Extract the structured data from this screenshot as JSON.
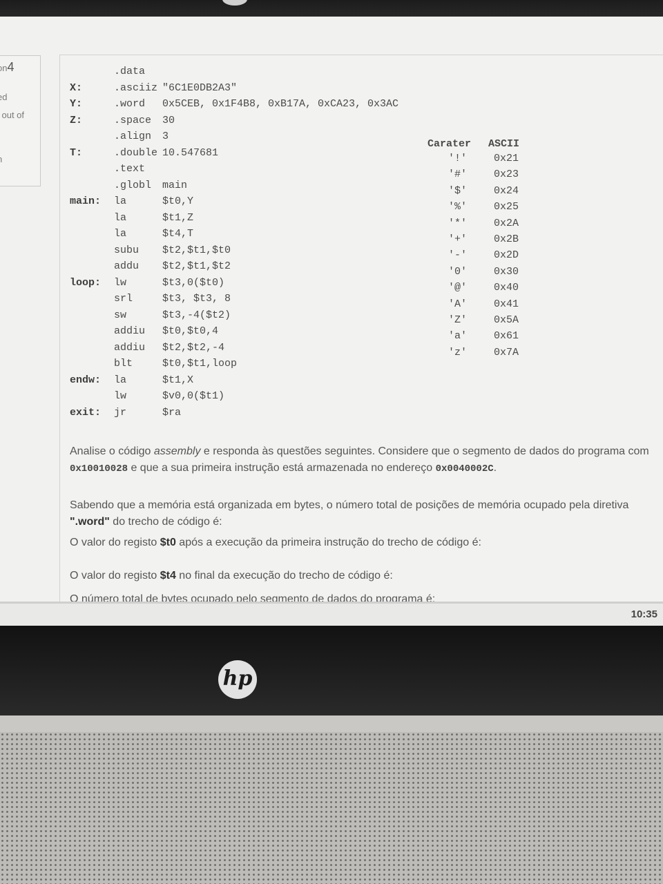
{
  "sidebar": {
    "question_prefix": "on",
    "question_number": "4",
    "line1": "ed",
    "line2": "l out of",
    "line3": "n"
  },
  "code": [
    {
      "label": "",
      "op": ".data",
      "args": ""
    },
    {
      "label": "X:",
      "op": ".asciiz",
      "args": "\"6C1E0DB2A3\""
    },
    {
      "label": "Y:",
      "op": ".word",
      "args": "0x5CEB, 0x1F4B8, 0xB17A, 0xCA23, 0x3AC"
    },
    {
      "label": "Z:",
      "op": ".space",
      "args": "30"
    },
    {
      "label": "",
      "op": ".align",
      "args": "3"
    },
    {
      "label": "T:",
      "op": ".double",
      "args": "10.547681"
    },
    {
      "label": "",
      "op": ".text",
      "args": ""
    },
    {
      "label": "",
      "op": ".globl",
      "args": "main"
    },
    {
      "label": "main:",
      "op": "la",
      "args": "$t0,Y"
    },
    {
      "label": "",
      "op": "la",
      "args": "$t1,Z"
    },
    {
      "label": "",
      "op": "la",
      "args": "$t4,T"
    },
    {
      "label": "",
      "op": "subu",
      "args": "$t2,$t1,$t0"
    },
    {
      "label": "",
      "op": "addu",
      "args": "$t2,$t1,$t2"
    },
    {
      "label": "loop:",
      "op": "lw",
      "args": "$t3,0($t0)"
    },
    {
      "label": "",
      "op": "srl",
      "args": "$t3, $t3, 8"
    },
    {
      "label": "",
      "op": "sw",
      "args": "$t3,-4($t2)"
    },
    {
      "label": "",
      "op": "addiu",
      "args": "$t0,$t0,4"
    },
    {
      "label": "",
      "op": "addiu",
      "args": "$t2,$t2,-4"
    },
    {
      "label": "",
      "op": "blt",
      "args": "$t0,$t1,loop"
    },
    {
      "label": "endw:",
      "op": "la",
      "args": "$t1,X"
    },
    {
      "label": "",
      "op": "lw",
      "args": "$v0,0($t1)"
    },
    {
      "label": "exit:",
      "op": "jr",
      "args": "$ra"
    }
  ],
  "ascii_table": {
    "header_char": "Carater",
    "header_ascii": "ASCII",
    "rows": [
      {
        "ch": "'!'",
        "hex": "0x21"
      },
      {
        "ch": "'#'",
        "hex": "0x23"
      },
      {
        "ch": "'$'",
        "hex": "0x24"
      },
      {
        "ch": "'%'",
        "hex": "0x25"
      },
      {
        "ch": "'*'",
        "hex": "0x2A"
      },
      {
        "ch": "'+'",
        "hex": "0x2B"
      },
      {
        "ch": "'-'",
        "hex": "0x2D"
      },
      {
        "ch": "'0'",
        "hex": "0x30"
      },
      {
        "ch": "'@'",
        "hex": "0x40"
      },
      {
        "ch": "'A'",
        "hex": "0x41"
      },
      {
        "ch": "'Z'",
        "hex": "0x5A"
      },
      {
        "ch": "'a'",
        "hex": "0x61"
      },
      {
        "ch": "'z'",
        "hex": "0x7A"
      }
    ]
  },
  "intro": {
    "p1_a": "Analise o código ",
    "p1_italic": "assembly",
    "p1_b": " e responda às questões seguintes. Considere que o segmento de dados do programa com",
    "addr_data": "0x10010028",
    "p2_a": " e que a sua primeira instrução está armazenada no endereço ",
    "addr_text": "0x0040002C",
    "p2_b": "."
  },
  "questions": {
    "q1_a": "Sabendo que a memória está organizada em bytes, o número total de posições de memória ocupado pela diretiva",
    "q1_bold": "\".word\"",
    "q1_b": " do trecho de código é:",
    "q2_a": "O valor do registo ",
    "q2_bold": "$t0",
    "q2_b": " após a execução da primeira instrução do trecho de código é:",
    "q3_a": "O valor do registo ",
    "q3_bold": "$t4",
    "q3_b": " no final da execução do trecho de código é:",
    "q4": "O número total de bytes ocupado pelo segmento de dados do programa é:"
  },
  "taskbar": {
    "clock": "10:35"
  },
  "laptop": {
    "logo": "hp"
  }
}
